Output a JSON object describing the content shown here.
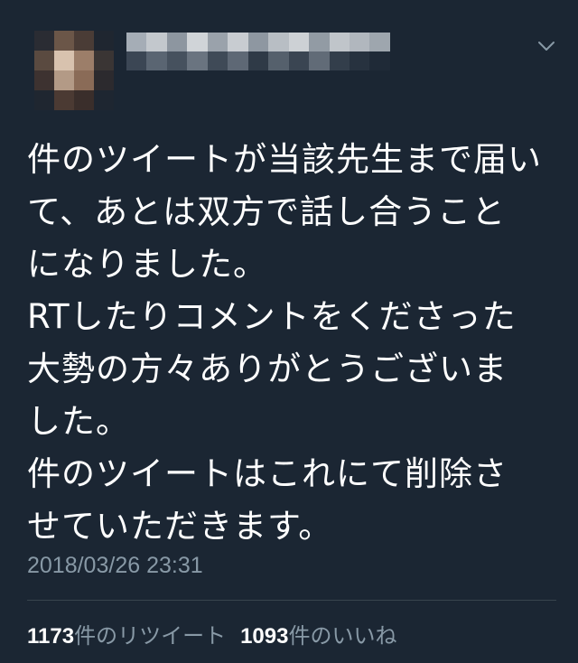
{
  "tweet": {
    "body_lines": [
      "件のツイートが当該先生まで届い",
      "て、あとは双方で話し合うこと",
      "になりました。",
      "RTしたりコメントをくださった",
      "大勢の方々ありがとうございま",
      "した。",
      "件のツイートはこれにて削除さ",
      "せていただきます。"
    ],
    "timestamp": "2018/03/26 23:31",
    "stats": {
      "retweets_count": "1173",
      "retweets_label": "件のリツイート",
      "likes_count": "1093",
      "likes_label": "件のいいね"
    },
    "menu_icon": "chevron-down-icon",
    "avatar_icon": "pixelated-avatar"
  },
  "colors": {
    "background": "#1b2633",
    "text": "#ffffff",
    "secondary_text": "#8899a6",
    "divider": "#38444d"
  }
}
